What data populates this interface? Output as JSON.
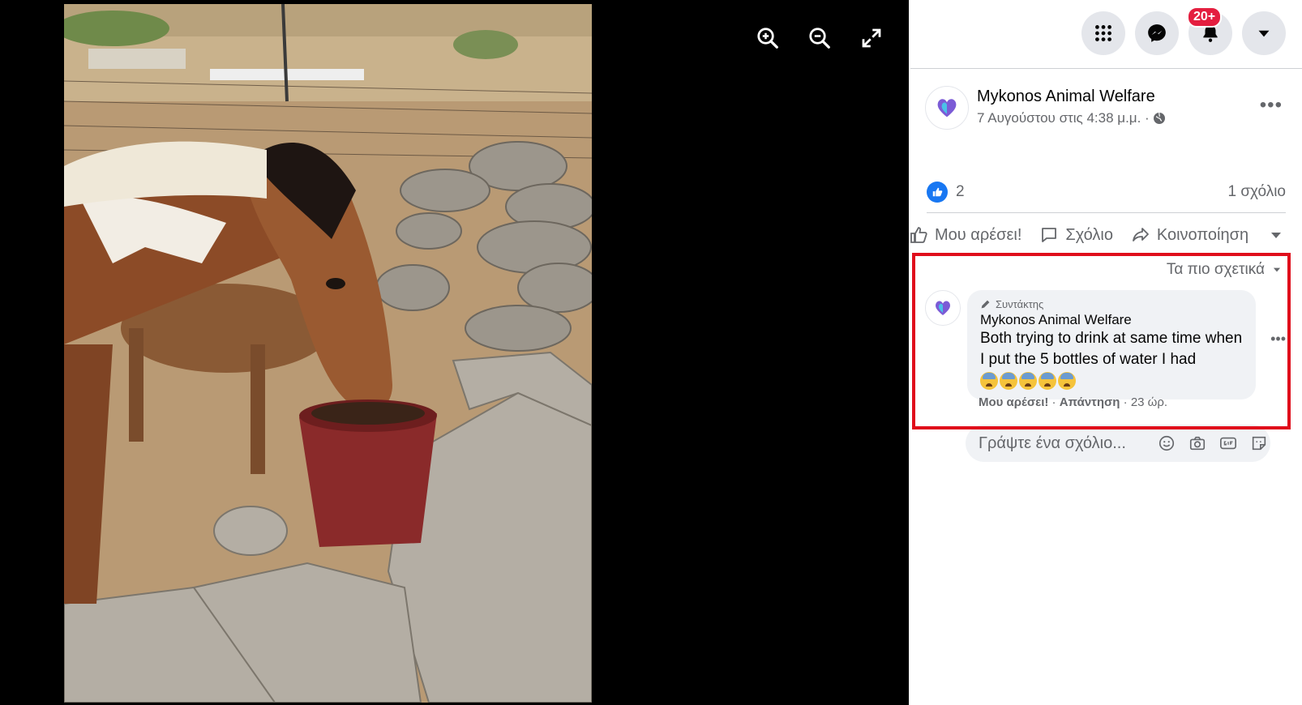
{
  "viewer": {
    "tools": [
      {
        "name": "zoom-in-icon"
      },
      {
        "name": "zoom-out-icon"
      },
      {
        "name": "fullscreen-icon"
      }
    ]
  },
  "topnav": {
    "notifications_badge": "20+"
  },
  "post": {
    "page_name": "Mykonos Animal Welfare",
    "timestamp": "7 Αυγούστου στις 4:38 μ.μ. ·",
    "more": "•••",
    "likes_count": "2",
    "comments_count": "1 σχόλιο",
    "actions": {
      "like": "Μου αρέσει!",
      "comment": "Σχόλιο",
      "share": "Κοινοποίηση"
    }
  },
  "comments": {
    "sort_label": "Τα πιο σχετικά",
    "items": [
      {
        "role": "Συντάκτης",
        "author": "Mykonos Animal Welfare",
        "text": "Both trying to drink at same time when I put the 5 bottles of water I had",
        "emoji_count": 5,
        "like_label": "Μου αρέσει!",
        "reply_label": "Απάντηση",
        "age": "23 ώρ."
      }
    ],
    "composer_placeholder": "Γράψτε ένα σχόλιο..."
  },
  "colors": {
    "highlight": "#e00d1b",
    "fb_blue": "#1877f2",
    "badge_red": "#e41e3f"
  }
}
